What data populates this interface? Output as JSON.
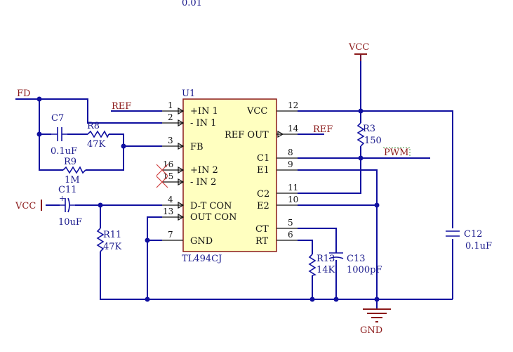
{
  "top_stub": "0.01",
  "ic": {
    "refdes": "U1",
    "part": "TL494CJ",
    "pins_left": [
      {
        "num": "1",
        "name": "+IN 1"
      },
      {
        "num": "2",
        "name": "- IN 1"
      },
      {
        "num": "3",
        "name": "FB"
      },
      {
        "num": "16",
        "name": "+IN 2"
      },
      {
        "num": "15",
        "name": "- IN 2"
      },
      {
        "num": "4",
        "name": "D-T CON"
      },
      {
        "num": "13",
        "name": "OUT CON"
      },
      {
        "num": "7",
        "name": "GND"
      }
    ],
    "pins_right": [
      {
        "num": "12",
        "name": "VCC"
      },
      {
        "num": "14",
        "name": "REF OUT"
      },
      {
        "num": "8",
        "name": "C1"
      },
      {
        "num": "9",
        "name": "E1"
      },
      {
        "num": "11",
        "name": "C2"
      },
      {
        "num": "10",
        "name": "E2"
      },
      {
        "num": "5",
        "name": "CT"
      },
      {
        "num": "6",
        "name": "RT"
      }
    ]
  },
  "nets": {
    "fd": "FD",
    "ref_left": "REF",
    "ref_right": "REF",
    "pwm": "PWM",
    "vcc_top": "VCC",
    "vcc_left": "VCC",
    "gnd": "GND"
  },
  "components": {
    "c7": {
      "ref": "C7",
      "value": "0.1uF"
    },
    "r8": {
      "ref": "R8",
      "value": "47K"
    },
    "r9": {
      "ref": "R9",
      "value": "1M"
    },
    "c11": {
      "ref": "C11",
      "value": "10uF"
    },
    "r11": {
      "ref": "R11",
      "value": "47K"
    },
    "r3": {
      "ref": "R3",
      "value": "150"
    },
    "r13": {
      "ref": "R13",
      "value": "14K"
    },
    "c13": {
      "ref": "C13",
      "value": "1000pF"
    },
    "c12": {
      "ref": "C12",
      "value": "0.1uF"
    }
  }
}
